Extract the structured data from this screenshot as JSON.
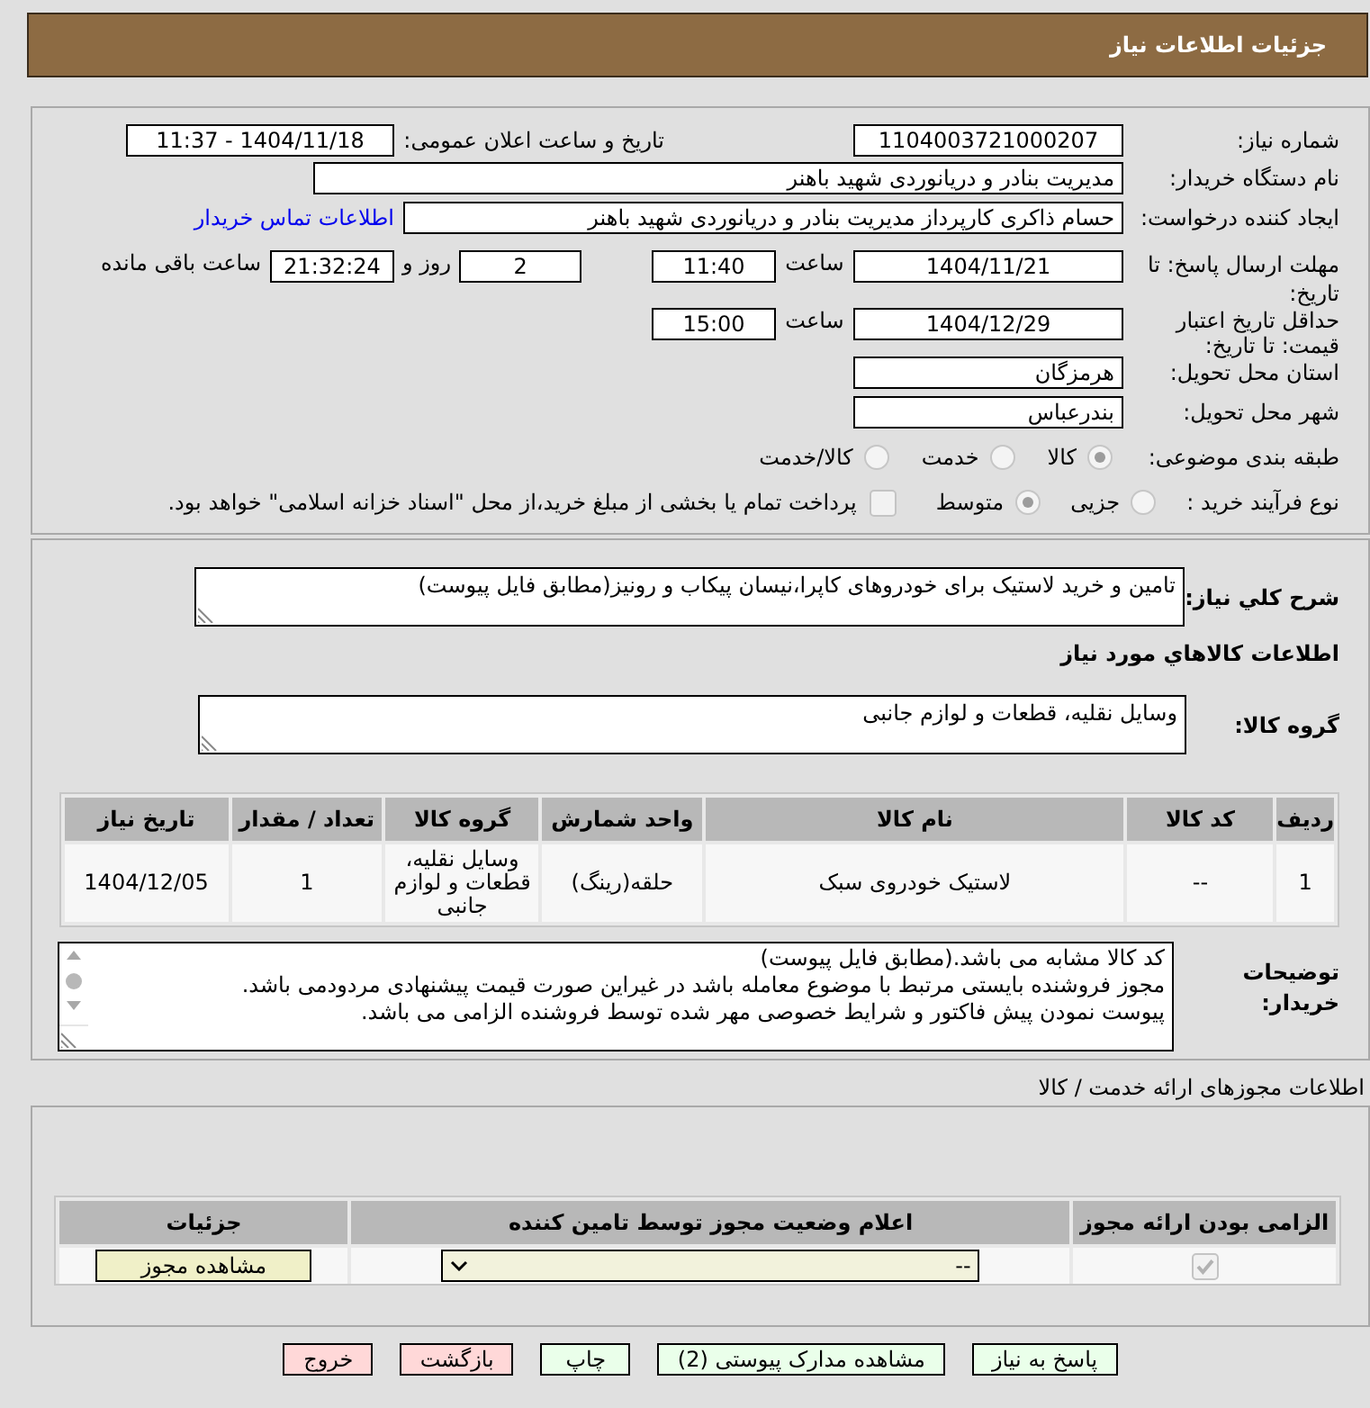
{
  "header": {
    "title": "جزئیات اطلاعات نیاز"
  },
  "details": {
    "need_number": {
      "label": "شماره نیاز:",
      "value": "1104003721000207"
    },
    "announcement": {
      "label": "تاریخ و ساعت اعلان عمومی:",
      "value": "1404/11/18 - 11:37"
    },
    "buyer": {
      "label": "نام دستگاه خریدار:",
      "value": "مدیریت بنادر و دریانوردی شهید باهنر"
    },
    "requester": {
      "label": "ایجاد کننده درخواست:",
      "value": "حسام ذاکری کارپرداز مدیریت بنادر و دریانوردی شهید باهنر",
      "link": "اطلاعات تماس خریدار"
    },
    "response_deadline": {
      "label": "مهلت ارسال پاسخ: تا تاریخ:",
      "date": "1404/11/21",
      "time_label": "ساعت",
      "time": "11:40",
      "days": "2",
      "days_label": "روز و",
      "remaining": "21:32:24",
      "remaining_label": "ساعت باقی مانده"
    },
    "price_validity": {
      "label": "حداقل تاریخ اعتبار قیمت: تا تاریخ:",
      "date": "1404/12/29",
      "time_label": "ساعت",
      "time": "15:00"
    },
    "province": {
      "label": "استان محل تحویل:",
      "value": "هرمزگان"
    },
    "city": {
      "label": "شهر محل تحویل:",
      "value": "بندرعباس"
    },
    "category": {
      "label": "طبقه بندی موضوعی:",
      "options": [
        {
          "label": "کالا",
          "selected": true
        },
        {
          "label": "خدمت",
          "selected": false
        },
        {
          "label": "کالا/خدمت",
          "selected": false
        }
      ]
    },
    "purchase_type": {
      "label": "نوع فرآیند خرید :",
      "options": [
        {
          "label": "جزیی",
          "selected": false
        },
        {
          "label": "متوسط",
          "selected": true
        }
      ],
      "treasury": {
        "label": "پرداخت تمام یا بخشی از مبلغ خرید،از محل \"اسناد خزانه اسلامی\" خواهد بود.",
        "checked": false
      }
    }
  },
  "need": {
    "summary_label": "شرح کلي نیاز:",
    "summary": "تامین و خرید لاستیک برای خودروهای کاپرا،نیسان پیکاب و رونیز(مطابق فایل پیوست)",
    "goods_heading": "اطلاعات کالاهاي مورد نیاز",
    "group_label": "گروه کالا:",
    "group": "وسایل نقلیه، قطعات و لوازم جانبی"
  },
  "goods_table": {
    "columns": [
      "ردیف",
      "کد کالا",
      "نام کالا",
      "واحد شمارش",
      "گروه کالا",
      "تعداد / مقدار",
      "تاریخ نیاز"
    ],
    "rows": [
      [
        "1",
        "--",
        "لاستیک خودروی سبک",
        "حلقه(رینگ)",
        "وسایل نقلیه، قطعات و لوازم جانبی",
        "1",
        "1404/12/05"
      ]
    ]
  },
  "buyer_notes": {
    "label": "توضیحات خریدار:",
    "lines": [
      "کد کالا مشابه می باشد.(مطابق فایل پیوست)",
      "مجوز فروشنده بایستی مرتبط با موضوع معامله باشد در غیراین صورت قیمت پیشنهادی مردودمی باشد.",
      "پیوست نمودن پیش فاکتور و شرایط خصوصی مهر شده توسط فروشنده الزامی می باشد."
    ]
  },
  "licenses": {
    "title": "اطلاعات مجوزهای ارائه خدمت / کالا",
    "columns": [
      "الزامی بودن ارائه مجوز",
      "اعلام وضعیت مجوز توسط تامین کننده",
      "جزئیات"
    ],
    "rows": [
      {
        "required": true,
        "status": "--",
        "action": "مشاهده مجوز"
      }
    ]
  },
  "buttons": [
    {
      "label": "پاسخ به نیاز",
      "color": "#eaffea"
    },
    {
      "label": "مشاهده مدارک پیوستی (2)",
      "color": "#eaffea"
    },
    {
      "label": "چاپ",
      "color": "#eaffea"
    },
    {
      "label": "بازگشت",
      "color": "#ffd8d8"
    },
    {
      "label": "خروج",
      "color": "#ffd8d8"
    }
  ]
}
